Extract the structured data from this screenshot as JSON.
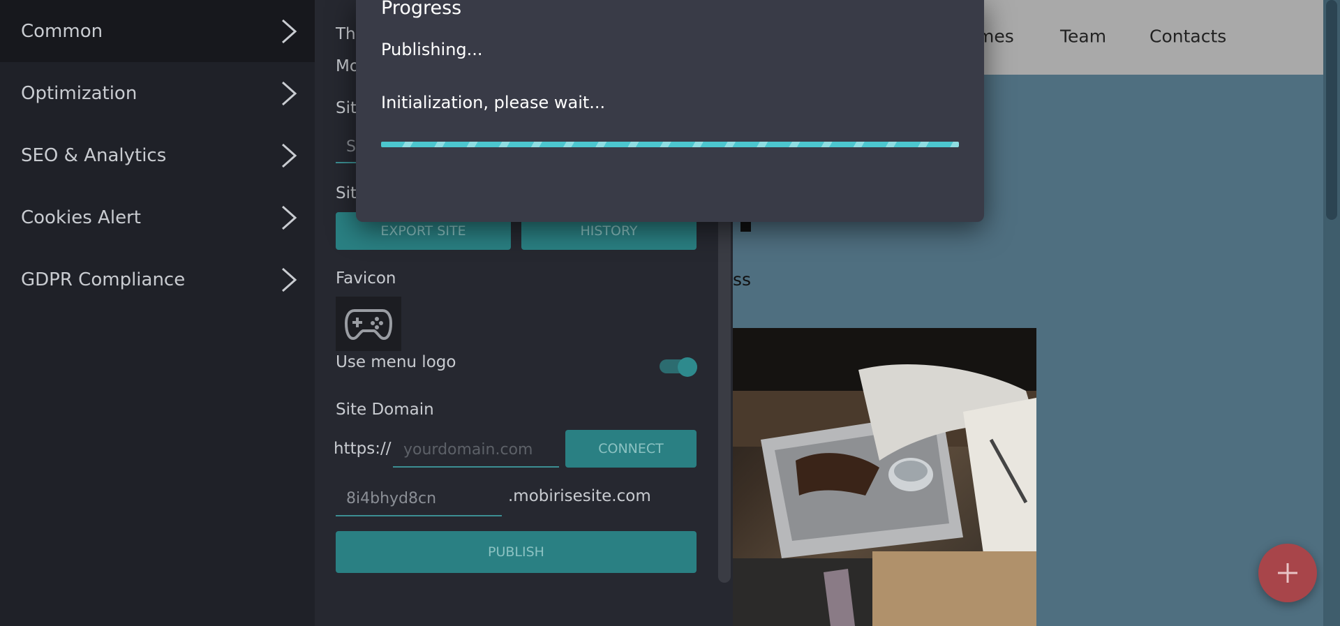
{
  "sidebar": {
    "items": [
      {
        "label": "Common",
        "active": true
      },
      {
        "label": "Optimization"
      },
      {
        "label": "SEO & Analytics"
      },
      {
        "label": "Cookies Alert"
      },
      {
        "label": "GDPR Compliance"
      }
    ]
  },
  "panel": {
    "partial": {
      "line1": "The",
      "line2": "Mo",
      "line3": "Site",
      "input_partial": "S",
      "line4": "Site"
    },
    "export_button": "EXPORT SITE",
    "history_button": "HISTORY",
    "favicon_label": "Favicon",
    "favicon_icon": "gamepad-icon",
    "use_menu_logo_label": "Use menu logo",
    "use_menu_logo_on": true,
    "site_domain_label": "Site Domain",
    "https_prefix": "https://",
    "domain_placeholder": "yourdomain.com",
    "connect_button": "CONNECT",
    "subdomain_value": "8i4bhyd8cn",
    "subdomain_suffix": ".mobirisesite.com",
    "publish_button": "PUBLISH"
  },
  "preview": {
    "nav": [
      "mes",
      "Team",
      "Contacts"
    ],
    "partial_text": "ss",
    "fab_icon": "plus-icon",
    "fab_color": "#a8454a"
  },
  "modal": {
    "title": "Progress",
    "status": "Publishing...",
    "message": "Initialization, please wait...",
    "progress_percent": 100,
    "accent": "#4cc6cf"
  }
}
